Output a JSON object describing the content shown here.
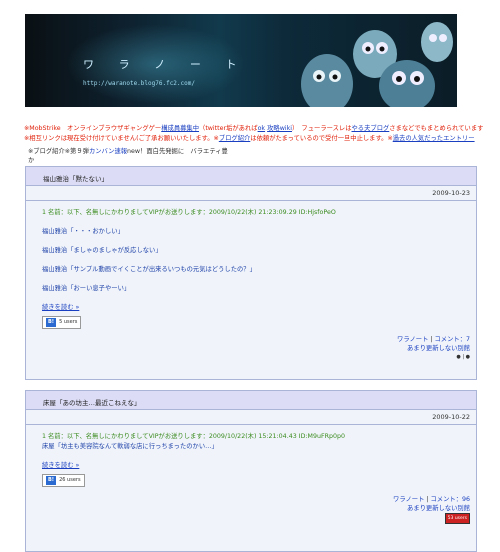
{
  "banner": {
    "title": "ワ ラ ノ ー ト",
    "url": "http://waranote.blog76.fc2.com/"
  },
  "ticker": {
    "line1_prefix": "※MobStrike　オンラインブラウザギャングゲー",
    "line1_link1": "構成員募集中",
    "line1_mid": "（twitter垢があれば",
    "line1_link2": "ok",
    "line1_mid2": "",
    "line1_link3": "攻略wiki",
    "line1_mid3": "）　フューラースレは",
    "line1_link4": "やる夫ブログ",
    "line1_end": "さまなどでもまとめられています",
    "line2_prefix": "※相互リンクは現在受け付けていません(ご了承お願いいたします。※",
    "line2_link1": "ブログ紹介",
    "line2_mid": "は依頼がたまっているので受付一旦中止します。※",
    "line2_link2": "過去の人気だったエントリー"
  },
  "bloglink": {
    "prefix": "※ブログ紹介※第９弾",
    "link": "カンバン速報",
    "suffix": "new！面白先発掘に　バラエティ豊か"
  },
  "entries": [
    {
      "title": "福山雅治「黙たない」",
      "date": "2009-10-23",
      "post_header": "1 名前：以下、名無しにかわりましてVIPがお送りします：2009/10/22(木) 21:23:09.29 ID:HjsfoPeO",
      "lines": [
        "福山雅治「・・・おかしい」",
        "福山雅治「ましゃのましゃが反応しない」",
        "福山雅治「サンプル動画でイくことが出来るいつもの元気はどうしたの？」",
        "福山雅治「おーい息子やーい」"
      ],
      "readmore": "続きを読む »",
      "hatena_count": "5 users",
      "footer_link1": "ワラノート",
      "footer_comment": "コメント：7",
      "footer_link2": "あまり更新しない別館",
      "footer_dots": "● | ●"
    },
    {
      "title": "床屋「あの坊主…最近こねえな」",
      "date": "2009-10-22",
      "post_header": "1 名前：以下、名無しにかわりましてVIPがお送りします：2009/10/22(木) 15:21:04.43 ID:M9uFRp0p0",
      "lines": [
        "床屋「坊主も美容院なんて軟弱な店に行っちまったのかい…」"
      ],
      "readmore": "続きを読む »",
      "hatena_count": "26 users",
      "footer_link1": "ワラノート",
      "footer_comment": "コメント：96",
      "footer_link2": "あまり更新しない別館",
      "footer_badge": "53 users"
    }
  ]
}
